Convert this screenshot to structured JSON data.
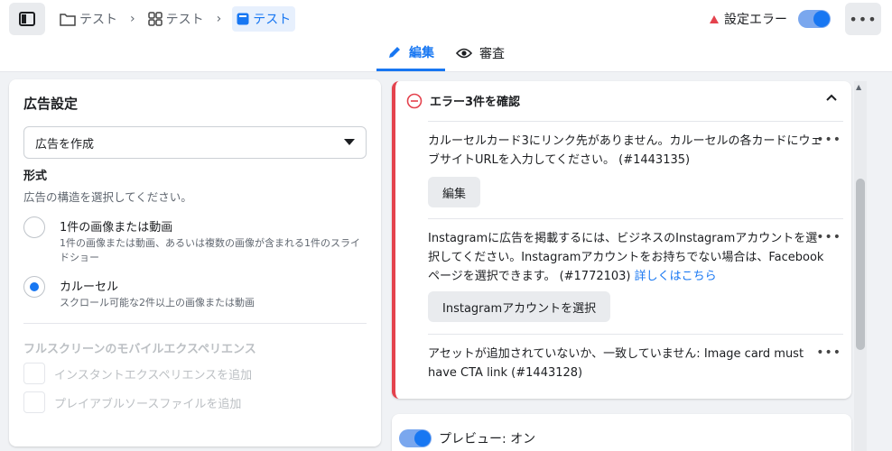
{
  "header": {
    "breadcrumbs": [
      {
        "label": "テスト",
        "icon": "folder-icon"
      },
      {
        "label": "テスト",
        "icon": "grid-icon"
      },
      {
        "label": "テスト",
        "icon": "ad-icon"
      }
    ],
    "status_label": "設定エラー",
    "status_color": "#e4424d",
    "toggle_on": true,
    "more_label": "•••"
  },
  "tabs": [
    {
      "label": "編集",
      "icon": "pencil-icon",
      "active": true
    },
    {
      "label": "審査",
      "icon": "eye-icon",
      "active": false
    }
  ],
  "ad_settings": {
    "title": "広告設定",
    "select_value": "広告を作成",
    "format_label": "形式",
    "format_help": "広告の構造を選択してください。",
    "options": [
      {
        "title": "1件の画像または動画",
        "desc": "1件の画像または動画、あるいは複数の画像が含まれる1件のスライドショー",
        "checked": false
      },
      {
        "title": "カルーセル",
        "desc": "スクロール可能な2件以上の画像または動画",
        "checked": true
      }
    ],
    "fullscreen_title": "フルスクリーンのモバイルエクスペリエンス",
    "checkboxes": [
      {
        "label": "インスタントエクスペリエンスを追加"
      },
      {
        "label": "プレイアブルソースファイルを追加"
      }
    ]
  },
  "errors": {
    "title": "エラー3件を確認",
    "items": [
      {
        "text": "カルーセルカード3にリンク先がありません。カルーセルの各カードにウェブサイトURLを入力してください。 (#1443135)",
        "link": "",
        "button": "編集"
      },
      {
        "text": "Instagramに広告を掲載するには、ビジネスのInstagramアカウントを選択してください。Instagramアカウントをお持ちでない場合は、Facebookページを選択できます。 (#1772103) ",
        "link": "詳しくはこちら",
        "button": "Instagramアカウントを選択"
      },
      {
        "text": "アセットが追加されていないか、一致していません: Image card must have CTA link (#1443128)",
        "link": "",
        "button": ""
      }
    ]
  },
  "preview": {
    "label": "プレビュー: オン",
    "on": true
  },
  "colors": {
    "accent": "#1877f2",
    "error": "#e4424d"
  }
}
